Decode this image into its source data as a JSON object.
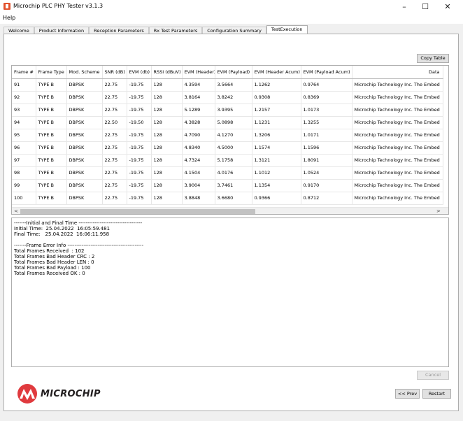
{
  "window": {
    "title": "Microchip PLC PHY Tester v3.1.3",
    "minimize": "–",
    "maximize": "☐",
    "close": "✕"
  },
  "menu": {
    "help": "Help"
  },
  "tabs": [
    {
      "label": "Welcome"
    },
    {
      "label": "Product Information"
    },
    {
      "label": "Reception Parameters"
    },
    {
      "label": "Rx Test Parameters"
    },
    {
      "label": "Configuration Summary"
    },
    {
      "label": "TestExecution",
      "active": true
    }
  ],
  "copy_table_label": "Copy Table",
  "table": {
    "columns": [
      "Frame #",
      "Frame Type",
      "Mod. Scheme",
      "SNR (dB)",
      "EVM (db)",
      "RSSI (dBuV)",
      "EVM (Header)",
      "EVM (Payload)",
      "EVM (Header Acum)",
      "EVM (Payload Acum)",
      "Data"
    ],
    "rows": [
      [
        "91",
        "TYPE B",
        "DBPSK",
        "22.75",
        "-19.75",
        "128",
        "4.3594",
        "3.5664",
        "1.1262",
        "0.9764",
        "Microchip Technology Inc. The Embed"
      ],
      [
        "92",
        "TYPE B",
        "DBPSK",
        "22.75",
        "-19.75",
        "128",
        "3.8164",
        "3.8242",
        "0.9308",
        "0.8369",
        "Microchip Technology Inc. The Embed"
      ],
      [
        "93",
        "TYPE B",
        "DBPSK",
        "22.75",
        "-19.75",
        "128",
        "5.1289",
        "3.9395",
        "1.2157",
        "1.0173",
        "Microchip Technology Inc. The Embed"
      ],
      [
        "94",
        "TYPE B",
        "DBPSK",
        "22.50",
        "-19.50",
        "128",
        "4.3828",
        "5.0898",
        "1.1231",
        "1.3255",
        "Microchip Technology Inc. The Embed"
      ],
      [
        "95",
        "TYPE B",
        "DBPSK",
        "22.75",
        "-19.75",
        "128",
        "4.7090",
        "4.1270",
        "1.3206",
        "1.0171",
        "Microchip Technology Inc. The Embed"
      ],
      [
        "96",
        "TYPE B",
        "DBPSK",
        "22.75",
        "-19.75",
        "128",
        "4.8340",
        "4.5000",
        "1.1574",
        "1.1596",
        "Microchip Technology Inc. The Embed"
      ],
      [
        "97",
        "TYPE B",
        "DBPSK",
        "22.75",
        "-19.75",
        "128",
        "4.7324",
        "5.1758",
        "1.3121",
        "1.8091",
        "Microchip Technology Inc. The Embed"
      ],
      [
        "98",
        "TYPE B",
        "DBPSK",
        "22.75",
        "-19.75",
        "128",
        "4.1504",
        "4.0176",
        "1.1012",
        "1.0524",
        "Microchip Technology Inc. The Embed"
      ],
      [
        "99",
        "TYPE B",
        "DBPSK",
        "22.75",
        "-19.75",
        "128",
        "3.9004",
        "3.7461",
        "1.1354",
        "0.9170",
        "Microchip Technology Inc. The Embed"
      ],
      [
        "100",
        "TYPE B",
        "DBPSK",
        "22.75",
        "-19.75",
        "128",
        "3.8848",
        "3.6680",
        "0.9366",
        "0.8712",
        "Microchip Technology Inc. The Embed"
      ]
    ]
  },
  "log_lines": [
    "-------Initial and Final Time ------------------------------------",
    "Initial Time:  25.04.2022  16:05:59.481",
    "Final Time:   25.04.2022  16:06:11.958",
    "",
    "-------Frame Error Info -------------------------------------------",
    "Total Frames Received  : 102",
    "Total Frames Bad Header CRC : 2",
    "Total Frames Bad Header LEN : 0",
    "Total Frames Bad Payload : 100",
    "Total Frames Received OK : 0"
  ],
  "cancel_label": "Cancel",
  "logo_text": "MICROCHIP",
  "prev_label": "<< Prev",
  "restart_label": "Restart",
  "colors": {
    "logo_red": "#e03a3e",
    "accent": "#e2522d"
  }
}
